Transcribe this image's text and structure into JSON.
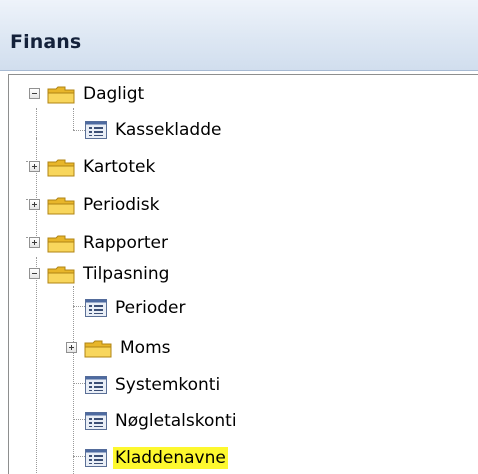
{
  "panel": {
    "title": "Finans"
  },
  "tree": {
    "items": [
      {
        "label": "Dagligt",
        "type": "folder",
        "expanded": true
      },
      {
        "label": "Kassekladde",
        "type": "form"
      },
      {
        "label": "Kartotek",
        "type": "folder",
        "expanded": false
      },
      {
        "label": "Periodisk",
        "type": "folder",
        "expanded": false
      },
      {
        "label": "Rapporter",
        "type": "folder",
        "expanded": false
      },
      {
        "label": "Tilpasning",
        "type": "folder",
        "expanded": true
      },
      {
        "label": "Perioder",
        "type": "form"
      },
      {
        "label": "Moms",
        "type": "folder",
        "expanded": false
      },
      {
        "label": "Systemkonti",
        "type": "form"
      },
      {
        "label": "Nøgletalskonti",
        "type": "form"
      },
      {
        "label": "Kladdenavne",
        "type": "form",
        "highlighted": true
      }
    ]
  },
  "colors": {
    "highlight": "#fdf82e",
    "header_bg": "#dde7f3",
    "folder": "#f3cf4e"
  },
  "icons": {
    "folder": "folder-icon",
    "form": "form-icon",
    "expand": "plus-box-icon",
    "collapse": "minus-box-icon"
  }
}
